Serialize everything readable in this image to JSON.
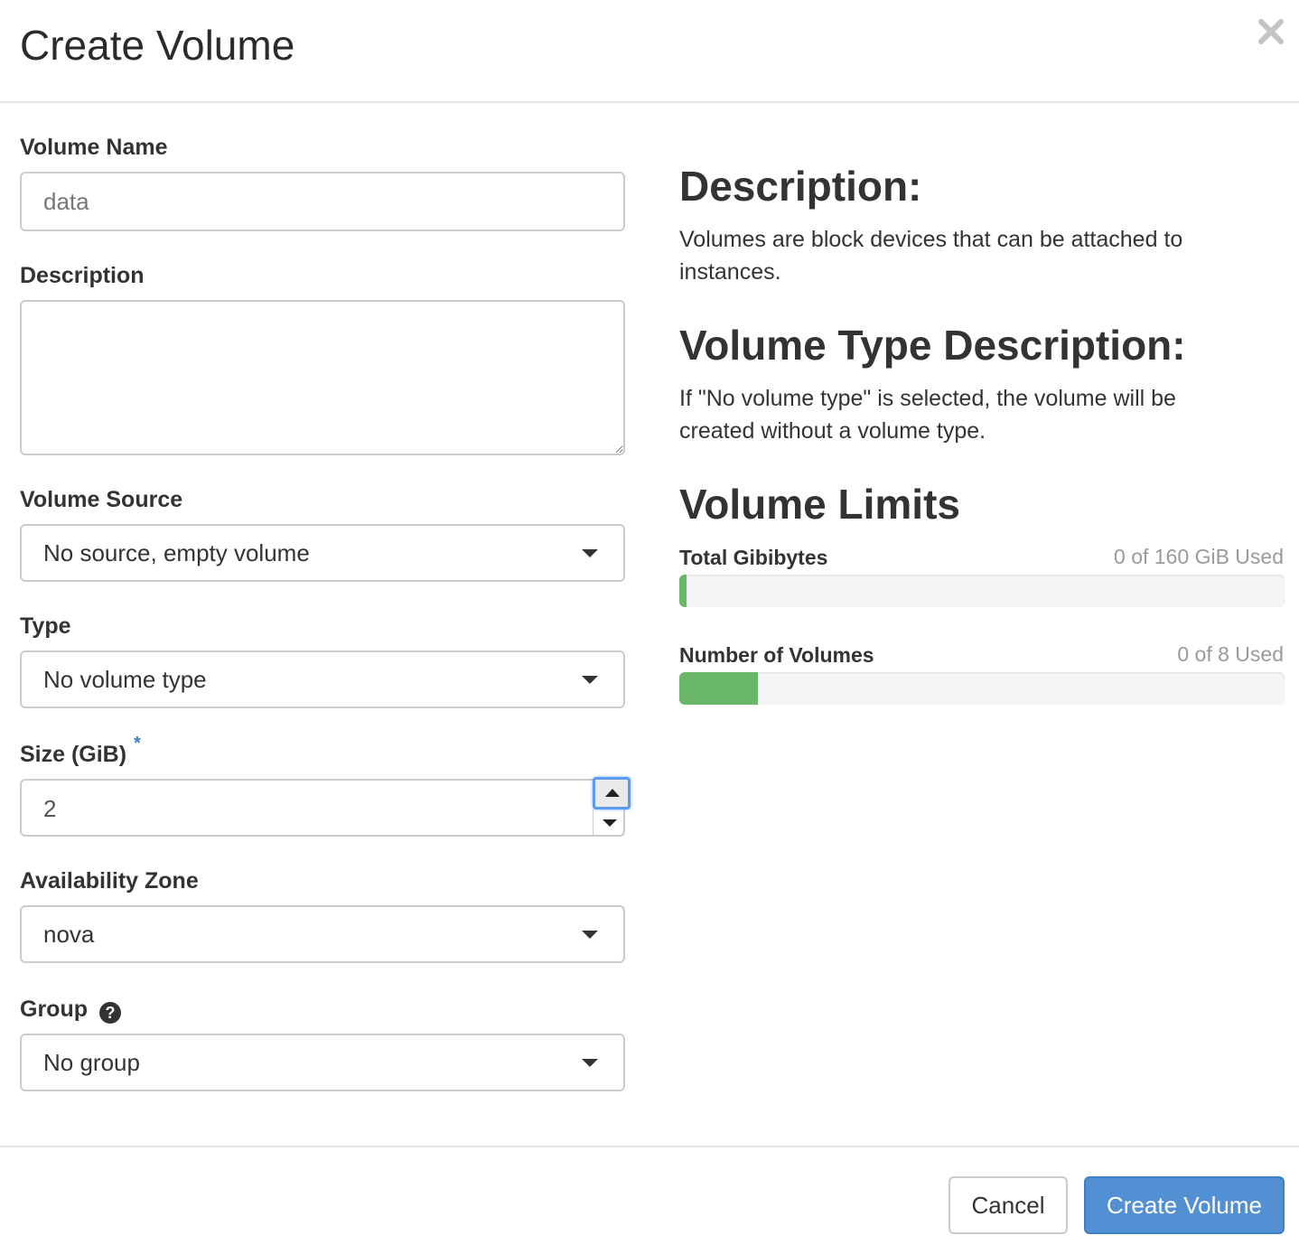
{
  "modal": {
    "title": "Create Volume",
    "close_icon": "close-icon"
  },
  "form": {
    "volume_name": {
      "label": "Volume Name",
      "placeholder": "data",
      "value": ""
    },
    "description": {
      "label": "Description",
      "value": ""
    },
    "volume_source": {
      "label": "Volume Source",
      "selected": "No source, empty volume"
    },
    "type": {
      "label": "Type",
      "selected": "No volume type"
    },
    "size": {
      "label": "Size (GiB)",
      "required_marker": "*",
      "value": "2"
    },
    "availability_zone": {
      "label": "Availability Zone",
      "selected": "nova"
    },
    "group": {
      "label": "Group",
      "help_icon": "question-circle-icon",
      "help_glyph": "?",
      "selected": "No group"
    }
  },
  "info": {
    "description_heading": "Description:",
    "description_text": "Volumes are block devices that can be attached to instances.",
    "type_heading": "Volume Type Description:",
    "type_text": "If \"No volume type\" is selected, the volume will be created without a volume type.",
    "limits_heading": "Volume Limits",
    "limits": [
      {
        "label": "Total Gibibytes",
        "used_text": "0 of 160 GiB Used",
        "fill_fraction": 0.012
      },
      {
        "label": "Number of Volumes",
        "used_text": "0 of 8 Used",
        "fill_fraction": 0.13
      }
    ],
    "accent_color": "#6ab76a"
  },
  "footer": {
    "cancel_label": "Cancel",
    "submit_label": "Create Volume",
    "primary_color": "#5390d3"
  }
}
